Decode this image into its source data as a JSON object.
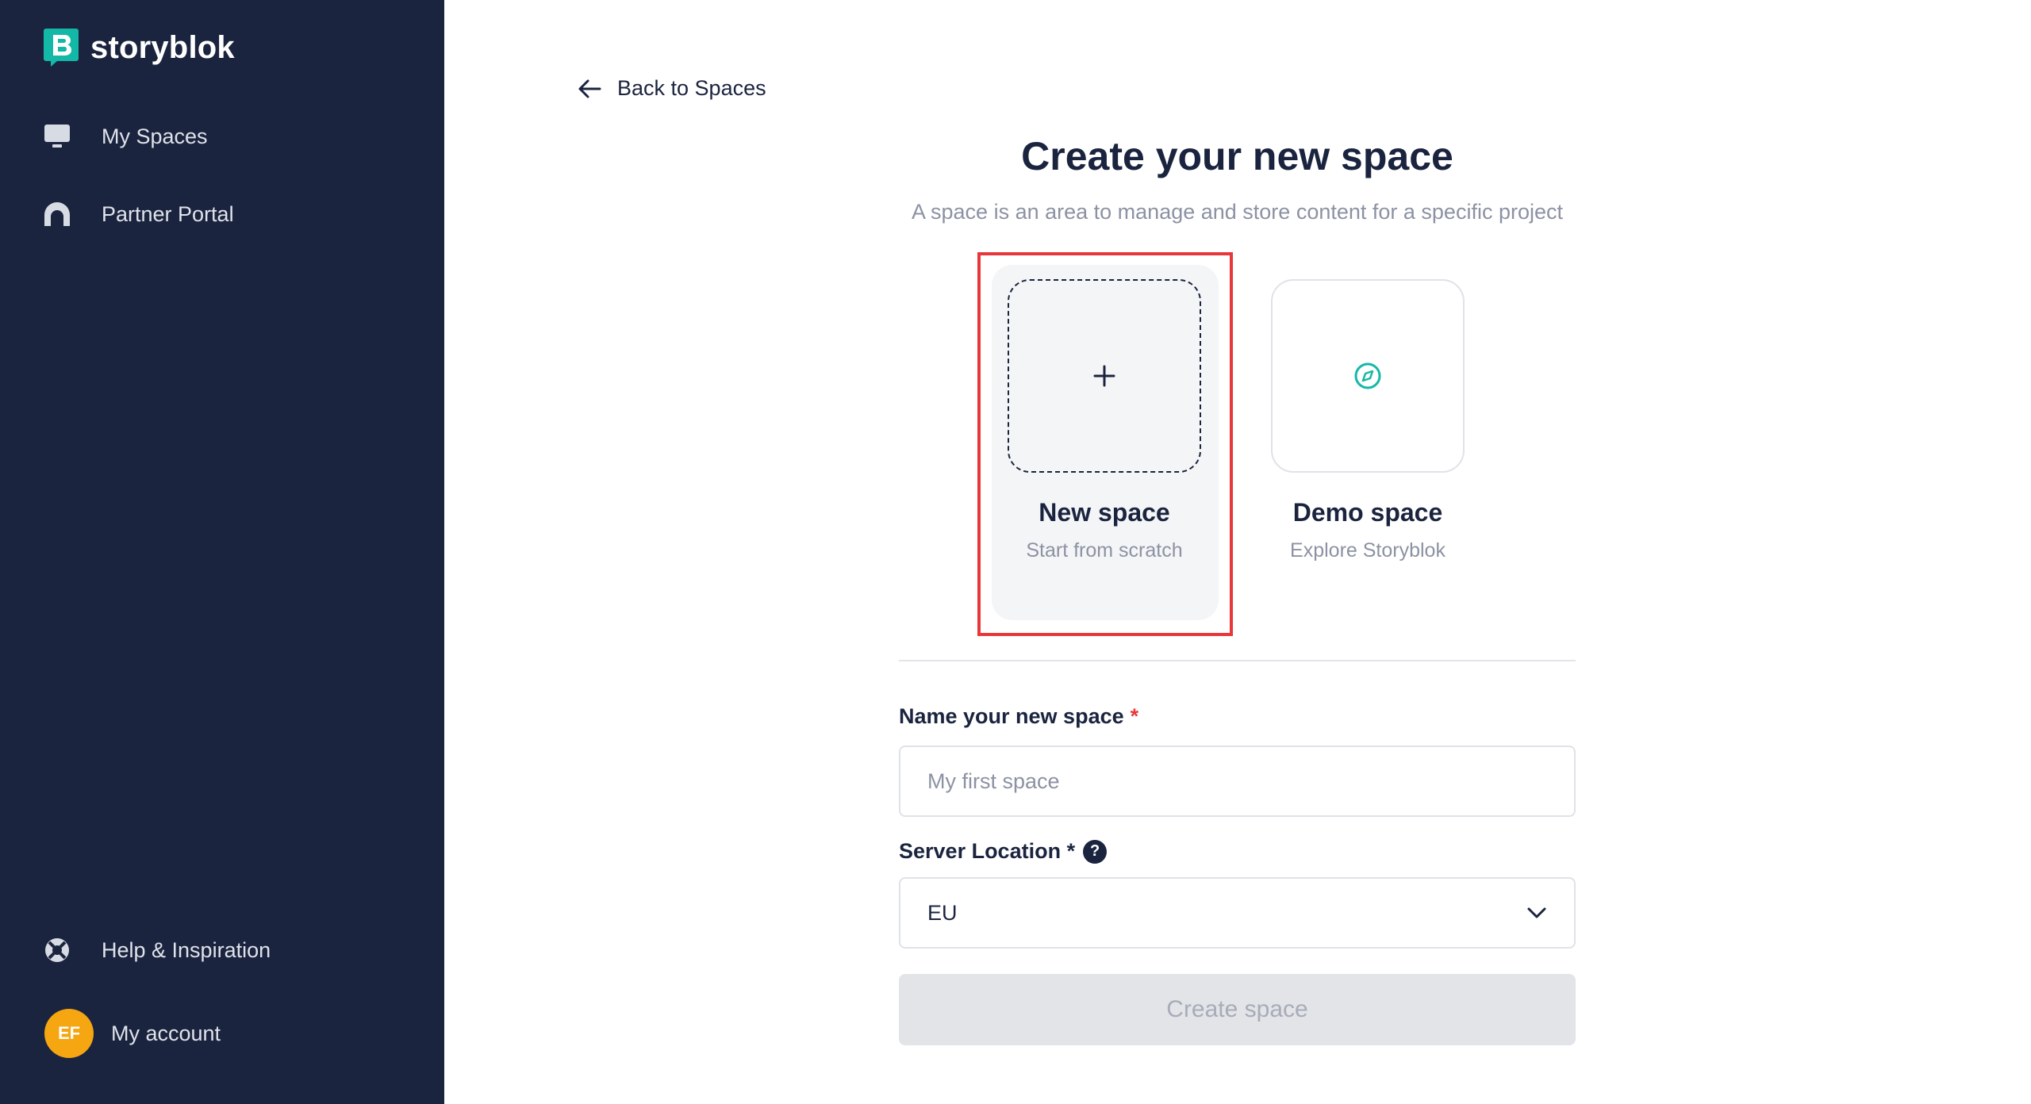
{
  "brand": {
    "name": "storyblok",
    "accent": "#14b8a6"
  },
  "sidebar": {
    "items": [
      {
        "label": "My Spaces",
        "icon": "monitor-icon"
      },
      {
        "label": "Partner Portal",
        "icon": "portal-arch-icon"
      }
    ],
    "footer": {
      "help_label": "Help & Inspiration",
      "account_label": "My account",
      "avatar_initials": "EF"
    }
  },
  "main": {
    "back_label": "Back to Spaces",
    "title": "Create your new space",
    "subtitle": "A space is an area to manage and store content for a specific project",
    "options": [
      {
        "title": "New space",
        "subtitle": "Start from scratch",
        "icon": "plus-icon",
        "selected": true
      },
      {
        "title": "Demo space",
        "subtitle": "Explore Storyblok",
        "icon": "compass-icon",
        "selected": false
      }
    ],
    "form": {
      "name_label": "Name your new space",
      "name_required": "*",
      "name_placeholder": "My first space",
      "name_value": "",
      "location_label": "Server Location *",
      "location_help": "?",
      "location_value": "EU",
      "submit_label": "Create space"
    }
  },
  "colors": {
    "sidebar_bg": "#1b243f",
    "highlight": "#e8373a",
    "avatar": "#f5a611"
  }
}
